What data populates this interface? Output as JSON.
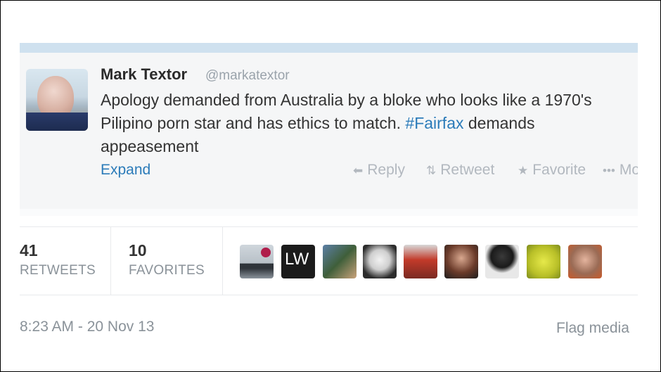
{
  "tweet": {
    "author_name": "Mark Textor",
    "author_handle": "@markatextor",
    "text_part1": "Apology demanded from Australia by a bloke who looks like a 1970's Pilipino porn star and has ethics to match. ",
    "hashtag": "#Fairfax",
    "text_part2": " demands appeasement",
    "expand_label": "Expand",
    "actions": {
      "reply": "Reply",
      "retweet": "Retweet",
      "favorite": "Favorite",
      "more": "More"
    }
  },
  "stats": {
    "retweets_count": "41",
    "retweets_label": "RETWEETS",
    "favorites_count": "10",
    "favorites_label": "FAVORITES"
  },
  "faces": {
    "lw_text": "LW"
  },
  "footer": {
    "timestamp": "8:23 AM - 20 Nov 13",
    "flag_media": "Flag media"
  },
  "colors": {
    "link": "#2b7bb9",
    "muted": "#8a9299",
    "card_bg": "#f5f6f7"
  }
}
